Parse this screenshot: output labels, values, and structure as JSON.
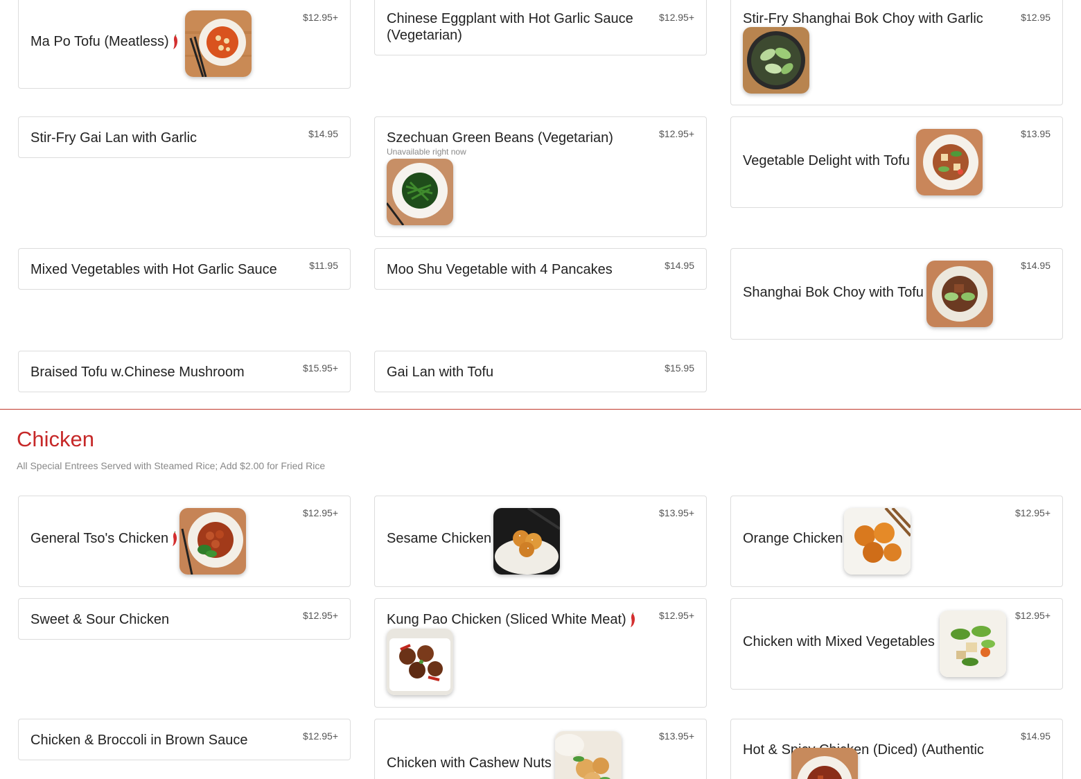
{
  "items": {
    "ma_po_tofu": {
      "name": "Ma Po Tofu (Meatless)",
      "price": "$12.95+"
    },
    "chinese_eggplant": {
      "name": "Chinese Eggplant with Hot Garlic Sauce (Vegetarian)",
      "price": "$12.95+"
    },
    "shanghai_bok_choy_garlic": {
      "name": "Stir-Fry Shanghai Bok Choy with Garlic",
      "price": "$12.95"
    },
    "gai_lan_garlic": {
      "name": "Stir-Fry Gai Lan with Garlic",
      "price": "$14.95"
    },
    "szechuan_green_beans": {
      "name": "Szechuan Green Beans (Vegetarian)",
      "price": "$12.95+",
      "note": "Unavailable right now"
    },
    "vegetable_delight_tofu": {
      "name": "Vegetable Delight with Tofu",
      "price": "$13.95"
    },
    "mixed_veg_hot_garlic": {
      "name": "Mixed Vegetables with Hot Garlic Sauce",
      "price": "$11.95"
    },
    "moo_shu_vegetable": {
      "name": "Moo Shu Vegetable with 4 Pancakes",
      "price": "$14.95"
    },
    "shanghai_bok_choy_tofu": {
      "name": "Shanghai Bok Choy with Tofu",
      "price": "$14.95"
    },
    "braised_tofu": {
      "name": "Braised Tofu w.Chinese Mushroom",
      "price": "$15.95+"
    },
    "gai_lan_tofu": {
      "name": "Gai Lan with Tofu",
      "price": "$15.95"
    },
    "general_tso": {
      "name": "General Tso's Chicken",
      "price": "$12.95+"
    },
    "sesame_chicken": {
      "name": "Sesame Chicken",
      "price": "$13.95+"
    },
    "orange_chicken": {
      "name": "Orange Chicken",
      "price": "$12.95+"
    },
    "sweet_sour_chicken": {
      "name": "Sweet & Sour Chicken",
      "price": "$12.95+"
    },
    "kung_pao_chicken": {
      "name": "Kung Pao Chicken (Sliced White Meat)",
      "price": "$12.95+"
    },
    "chicken_mixed_veg": {
      "name": "Chicken with Mixed Vegetables",
      "price": "$12.95+"
    },
    "chicken_broccoli": {
      "name": "Chicken & Broccoli in Brown Sauce",
      "price": "$12.95+"
    },
    "chicken_cashew": {
      "name": "Chicken with Cashew Nuts",
      "price": "$13.95+"
    },
    "hot_spicy_chicken": {
      "name": "Hot & Spicy Chicken (Diced) (Authentic Style)",
      "price": "$14.95"
    }
  },
  "sections": {
    "chicken": {
      "title": "Chicken",
      "description": "All Special Entrees Served with Steamed Rice; Add $2.00 for Fried Rice"
    }
  },
  "icons": {
    "spicy": "chili-pepper-icon"
  },
  "colors": {
    "section_title": "#c62828",
    "divider": "#c0392b",
    "chili": "#d32f2f"
  }
}
